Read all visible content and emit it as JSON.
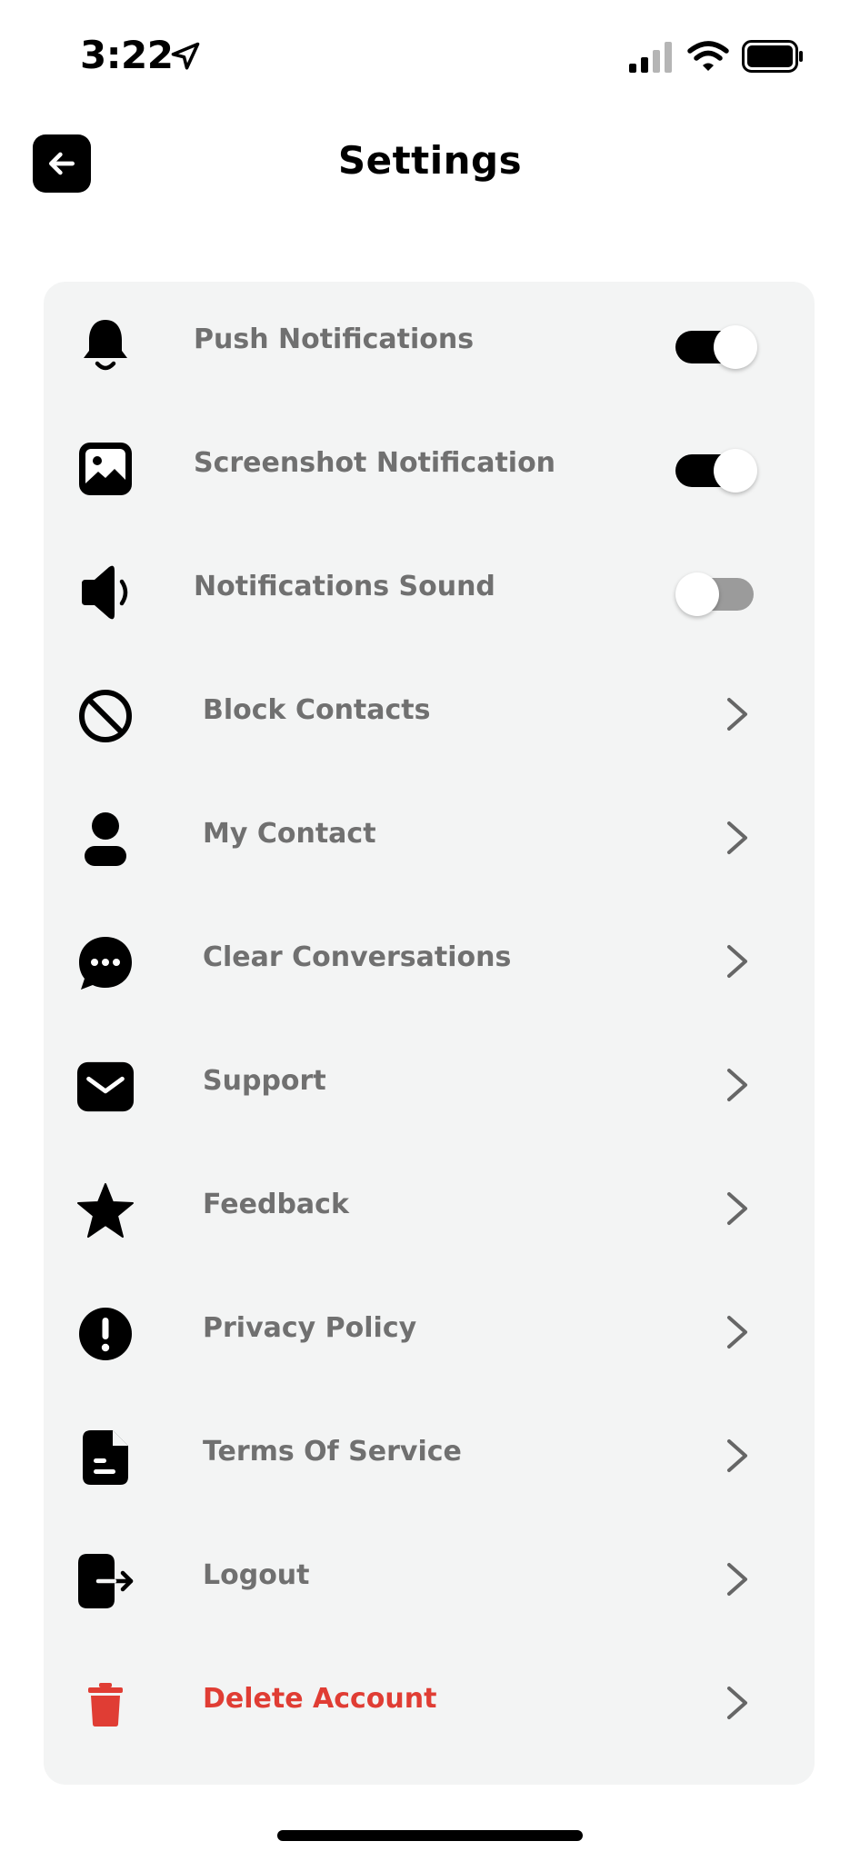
{
  "status_bar": {
    "time": "3:22"
  },
  "header": {
    "title": "Settings",
    "back_icon": "arrow-left-icon"
  },
  "settings": {
    "toggles": [
      {
        "label": "Push Notifications",
        "icon": "bell-icon",
        "enabled": true
      },
      {
        "label": "Screenshot Notification",
        "icon": "image-icon",
        "enabled": true
      },
      {
        "label": "Notifications Sound",
        "icon": "speaker-icon",
        "enabled": false
      }
    ],
    "links": [
      {
        "label": "Block Contacts",
        "icon": "block-icon"
      },
      {
        "label": "My Contact",
        "icon": "person-icon"
      },
      {
        "label": "Clear Conversations",
        "icon": "chat-bubble-icon"
      },
      {
        "label": "Support",
        "icon": "mail-icon"
      },
      {
        "label": "Feedback",
        "icon": "star-icon"
      },
      {
        "label": "Privacy Policy",
        "icon": "exclamation-icon"
      },
      {
        "label": "Terms Of Service",
        "icon": "document-icon"
      },
      {
        "label": "Logout",
        "icon": "logout-icon"
      },
      {
        "label": "Delete Account",
        "icon": "trash-icon",
        "color": "#e03d34"
      }
    ]
  },
  "colors": {
    "card_bg": "#f3f4f4",
    "label": "#707070",
    "danger": "#e03d34",
    "toggle_on": "#000000",
    "toggle_off": "#9b9b9b"
  }
}
